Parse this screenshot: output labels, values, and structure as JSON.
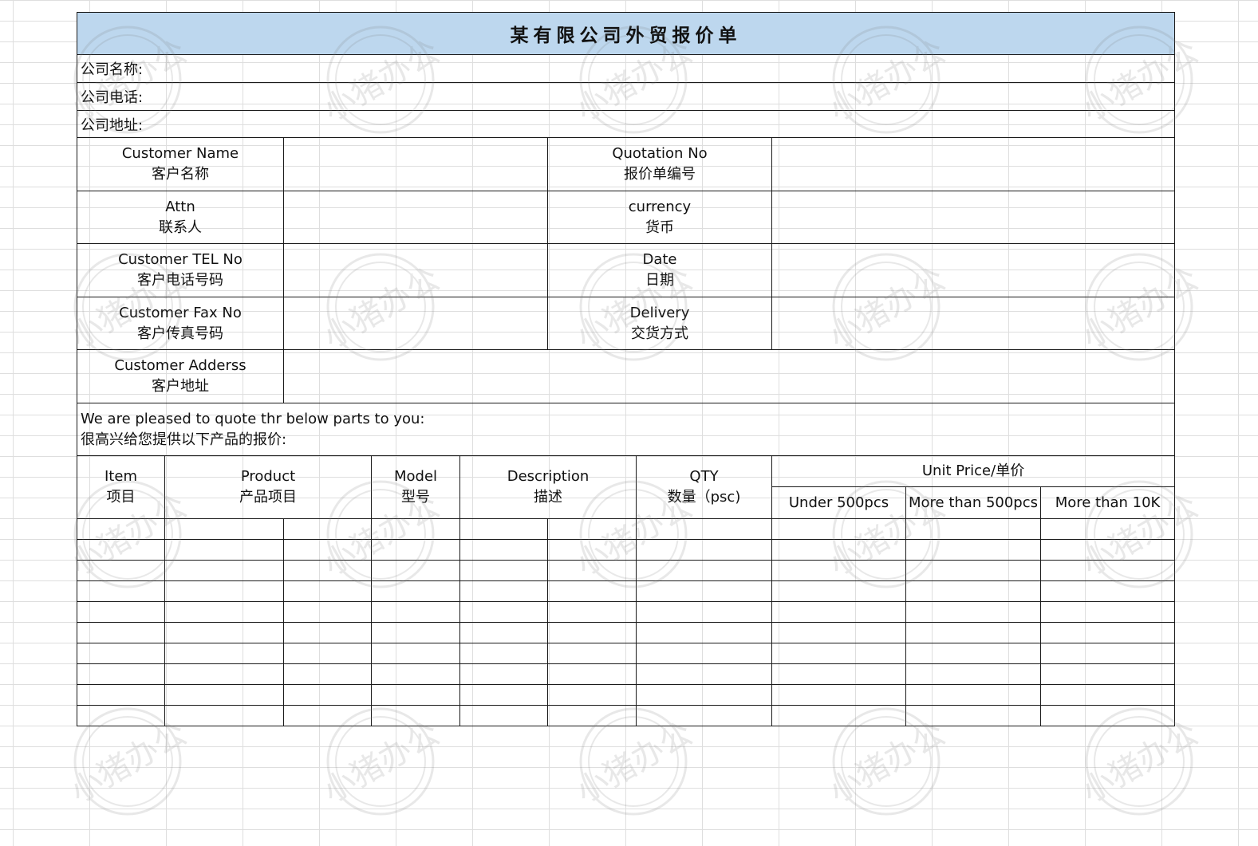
{
  "title": "某有限公司外贸报价单",
  "company": {
    "name_label": "公司名称:",
    "phone_label": "公司电话:",
    "address_label": "公司地址:"
  },
  "info_rows": [
    {
      "label_en": "Customer Name",
      "label_cn": "客户名称",
      "label2_en": "Quotation No",
      "label2_cn": "报价单编号"
    },
    {
      "label_en": "Attn",
      "label_cn": "联系人",
      "label2_en": "currency",
      "label2_cn": "货币"
    },
    {
      "label_en": "Customer TEL No",
      "label_cn": "客户电话号码",
      "label2_en": "Date",
      "label2_cn": "日期"
    },
    {
      "label_en": "Customer Fax No",
      "label_cn": "客户传真号码",
      "label2_en": "Delivery",
      "label2_cn": "交货方式"
    }
  ],
  "address_row": {
    "label_en": "Customer Adderss",
    "label_cn": "客户地址"
  },
  "message": {
    "en": "We are pleased to quote thr below parts to you:",
    "cn": "很高兴给您提供以下产品的报价:"
  },
  "table_header": {
    "item_en": "Item",
    "item_cn": "项目",
    "product_en": "Product",
    "product_cn": "产品项目",
    "model_en": "Model",
    "model_cn": "型号",
    "description_en": "Description",
    "description_cn": "描述",
    "qty_en": "QTY",
    "qty_cn": "数量（psc)",
    "unit_price": "Unit Price/单价",
    "price_tiers": [
      "Under 500pcs",
      "More than 500pcs",
      "More than 10K"
    ]
  },
  "watermark_text": "小猪办公",
  "empty_row_count": 10
}
